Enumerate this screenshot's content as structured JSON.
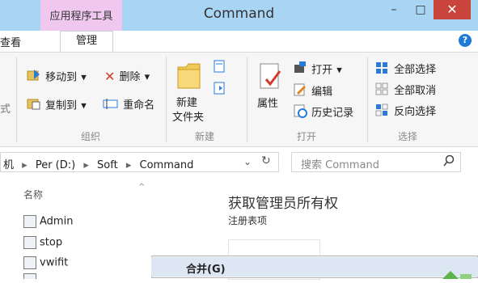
{
  "window": {
    "title": "Command",
    "context_tab": "应用程序工具",
    "controls": {
      "minimize": "–",
      "maximize": "□",
      "close": "✕"
    }
  },
  "tabs": {
    "view": "查看",
    "manage": "管理"
  },
  "help": "?",
  "ribbon": {
    "organize": {
      "move_to": "移动到",
      "copy_to": "复制到",
      "delete": "删除",
      "rename": "重命名",
      "label": "组织",
      "partial_left": "式"
    },
    "new": {
      "new_folder_line1": "新建",
      "new_folder_line2": "文件夹",
      "label": "新建"
    },
    "open": {
      "properties": "属性",
      "open": "打开",
      "edit": "编辑",
      "history": "历史记录",
      "label": "打开"
    },
    "select": {
      "select_all": "全部选择",
      "select_none": "全部取消",
      "invert": "反向选择",
      "label": "选择"
    }
  },
  "address": {
    "segments": [
      "机",
      "Per (D:)",
      "Soft",
      "Command"
    ],
    "separator": "▸",
    "search_placeholder": "搜索 Command"
  },
  "filelist": {
    "column_name": "名称",
    "items": [
      "Admin",
      "stop",
      "vwifit"
    ]
  },
  "preview": {
    "title": "获取管理员所有权",
    "subtitle": "注册表项"
  },
  "context_menu": {
    "item": "合并(G)"
  }
}
